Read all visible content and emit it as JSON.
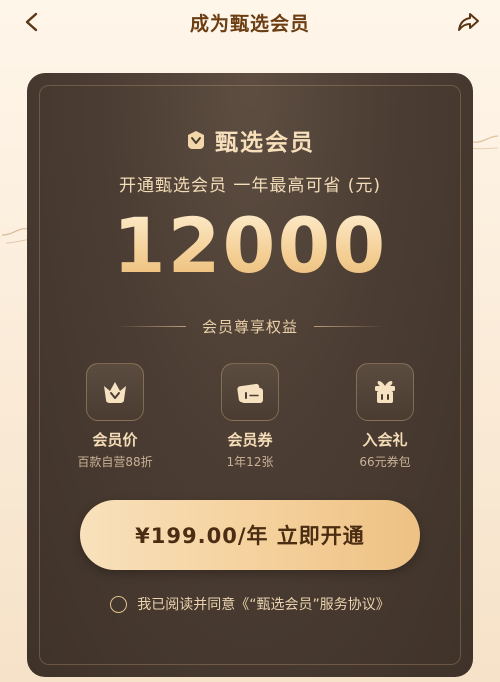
{
  "nav": {
    "title": "成为甄选会员",
    "back_icon": "chevron-left-icon",
    "share_icon": "share-arrow-icon"
  },
  "card": {
    "brand_name": "甄选会员",
    "brand_icon": "membership-badge-icon",
    "subtitle": "开通甄选会员 一年最高可省 (元)",
    "amount": "12000",
    "benefits_header": "会员尊享权益",
    "benefits": [
      {
        "title": "会员价",
        "desc": "百款自营88折",
        "icon": "crown-icon"
      },
      {
        "title": "会员券",
        "desc": "1年12张",
        "icon": "coupon-icon"
      },
      {
        "title": "入会礼",
        "desc": "66元券包",
        "icon": "gift-icon"
      }
    ],
    "cta_label": "¥199.00/年 立即开通",
    "agreement": "我已阅读并同意《“甄选会员”服务协议》"
  },
  "colors": {
    "card_bg": "#4b3d33",
    "gold_text": "#f6dfba",
    "button_gold": "#f5d29e",
    "nav_text": "#6b3d12"
  }
}
